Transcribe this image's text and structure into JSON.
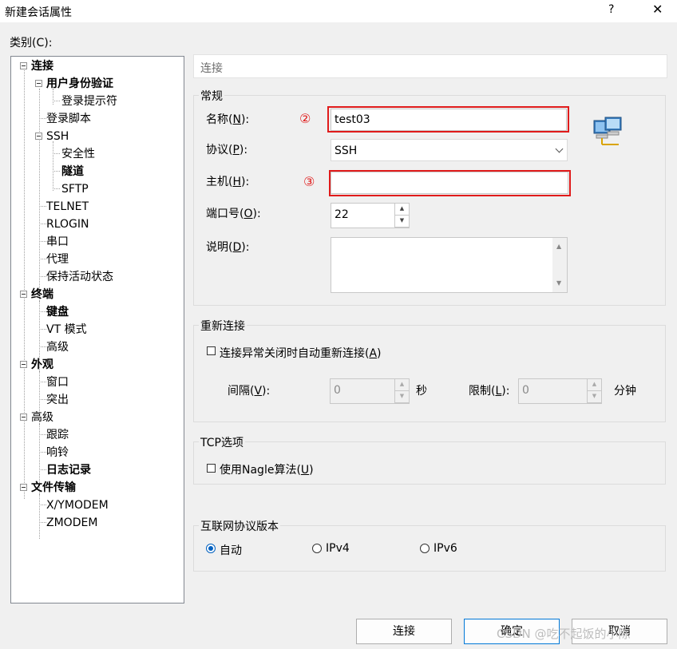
{
  "window": {
    "title": "新建会话属性",
    "help": "?",
    "close": "✕"
  },
  "category_label": "类别(C):",
  "tree": [
    {
      "label": "连接",
      "bold": true
    },
    {
      "label": "用户身份验证",
      "bold": true
    },
    {
      "label": "登录提示符",
      "bold": false
    },
    {
      "label": "登录脚本",
      "bold": false
    },
    {
      "label": "SSH",
      "bold": false
    },
    {
      "label": "安全性",
      "bold": false
    },
    {
      "label": "隧道",
      "bold": true
    },
    {
      "label": "SFTP",
      "bold": false
    },
    {
      "label": "TELNET",
      "bold": false
    },
    {
      "label": "RLOGIN",
      "bold": false
    },
    {
      "label": "串口",
      "bold": false
    },
    {
      "label": "代理",
      "bold": false
    },
    {
      "label": "保持活动状态",
      "bold": false
    },
    {
      "label": "终端",
      "bold": true
    },
    {
      "label": "键盘",
      "bold": true
    },
    {
      "label": "VT 模式",
      "bold": false
    },
    {
      "label": "高级",
      "bold": false
    },
    {
      "label": "外观",
      "bold": true
    },
    {
      "label": "窗口",
      "bold": false
    },
    {
      "label": "突出",
      "bold": false
    },
    {
      "label": "高级",
      "bold": false
    },
    {
      "label": "跟踪",
      "bold": false
    },
    {
      "label": "响铃",
      "bold": false
    },
    {
      "label": "日志记录",
      "bold": true
    },
    {
      "label": "文件传输",
      "bold": true
    },
    {
      "label": "X/YMODEM",
      "bold": false
    },
    {
      "label": "ZMODEM",
      "bold": false
    }
  ],
  "header": "连接",
  "general": {
    "title": "常规",
    "name_label_pre": "名称(",
    "name_key": "N",
    "name_label_post": "):",
    "name_value": "test03",
    "protocol_label_pre": "协议(",
    "protocol_key": "P",
    "protocol_label_post": "):",
    "protocol_value": "SSH",
    "host_label_pre": "主机(",
    "host_key": "H",
    "host_label_post": "):",
    "host_value": "",
    "port_label_pre": "端口号(",
    "port_key": "O",
    "port_label_post": "):",
    "port_value": "22",
    "desc_label_pre": "说明(",
    "desc_key": "D",
    "desc_label_post": "):",
    "anno_name": "②",
    "anno_host": "③"
  },
  "reconnect": {
    "title": "重新连接",
    "checkbox_label_pre": "连接异常关闭时自动重新连接(",
    "checkbox_key": "A",
    "checkbox_label_post": ")",
    "interval_label_pre": "间隔(",
    "interval_key": "V",
    "interval_label_post": "):",
    "interval_value": "0",
    "interval_unit": "秒",
    "limit_label_pre": "限制(",
    "limit_key": "L",
    "limit_label_post": "):",
    "limit_value": "0",
    "limit_unit": "分钟"
  },
  "tcp": {
    "title": "TCP选项",
    "nagle_pre": "使用Nagle算法(",
    "nagle_key": "U",
    "nagle_post": ")"
  },
  "ipver": {
    "title": "互联网协议版本",
    "auto": "自动",
    "ipv4": "IPv4",
    "ipv6": "IPv6"
  },
  "buttons": {
    "connect": "连接",
    "ok": "确定",
    "cancel": "取消"
  },
  "watermark": "CSDN @吃不起饭的小陈"
}
